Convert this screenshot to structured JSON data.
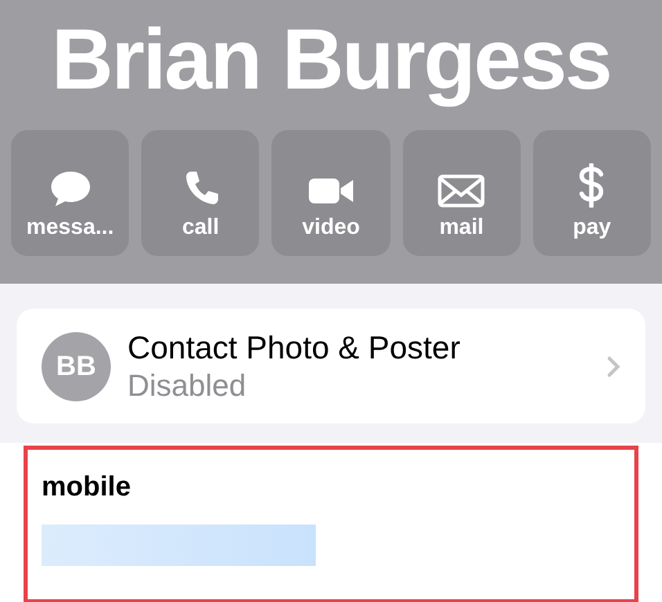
{
  "contact": {
    "name": "Brian Burgess"
  },
  "actions": [
    {
      "kind": "message",
      "label": "messa..."
    },
    {
      "kind": "call",
      "label": "call"
    },
    {
      "kind": "video",
      "label": "video"
    },
    {
      "kind": "mail",
      "label": "mail"
    },
    {
      "kind": "pay",
      "label": "pay"
    }
  ],
  "poster_card": {
    "initials": "BB",
    "title": "Contact Photo & Poster",
    "status": "Disabled"
  },
  "phone_card": {
    "label": "mobile",
    "highlighted": true
  }
}
